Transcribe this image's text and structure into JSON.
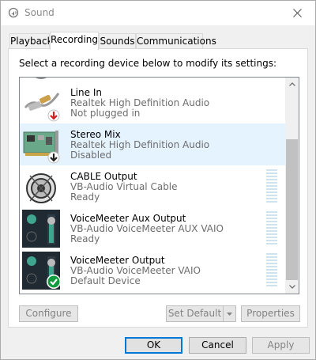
{
  "window": {
    "title": "Sound",
    "icon": "speaker-icon"
  },
  "tabs": [
    {
      "label": "Playback",
      "active": false
    },
    {
      "label": "Recording",
      "active": true
    },
    {
      "label": "Sounds",
      "active": false
    },
    {
      "label": "Communications",
      "active": false
    }
  ],
  "recording": {
    "instruction": "Select a recording device below to modify its settings:",
    "devices": [
      {
        "name": "Line In",
        "driver": "Realtek High Definition Audio",
        "status": "Not plugged in",
        "icon": "line-in-jack-icon",
        "badge": "red-down-arrow"
      },
      {
        "name": "Stereo Mix",
        "driver": "Realtek High Definition Audio",
        "status": "Disabled",
        "icon": "sound-card-icon",
        "badge": "black-down-arrow",
        "selected": true
      },
      {
        "name": "CABLE Output",
        "driver": "VB-Audio Virtual Cable",
        "status": "Ready",
        "icon": "cable-speaker-icon"
      },
      {
        "name": "VoiceMeeter Aux Output",
        "driver": "VB-Audio VoiceMeeter AUX VAIO",
        "status": "Ready",
        "icon": "voicemeeter-icon"
      },
      {
        "name": "VoiceMeeter Output",
        "driver": "VB-Audio VoiceMeeter VAIO",
        "status": "Default Device",
        "icon": "voicemeeter-icon",
        "badge": "green-check"
      }
    ],
    "buttons": {
      "configure": "Configure",
      "set_default": "Set Default",
      "properties": "Properties"
    }
  },
  "footer": {
    "ok": "OK",
    "cancel": "Cancel",
    "apply": "Apply"
  },
  "colors": {
    "selected_row": "#e5f3ff",
    "default_button_border": "#0078d7",
    "meter_bar": "#cfe3ef"
  }
}
